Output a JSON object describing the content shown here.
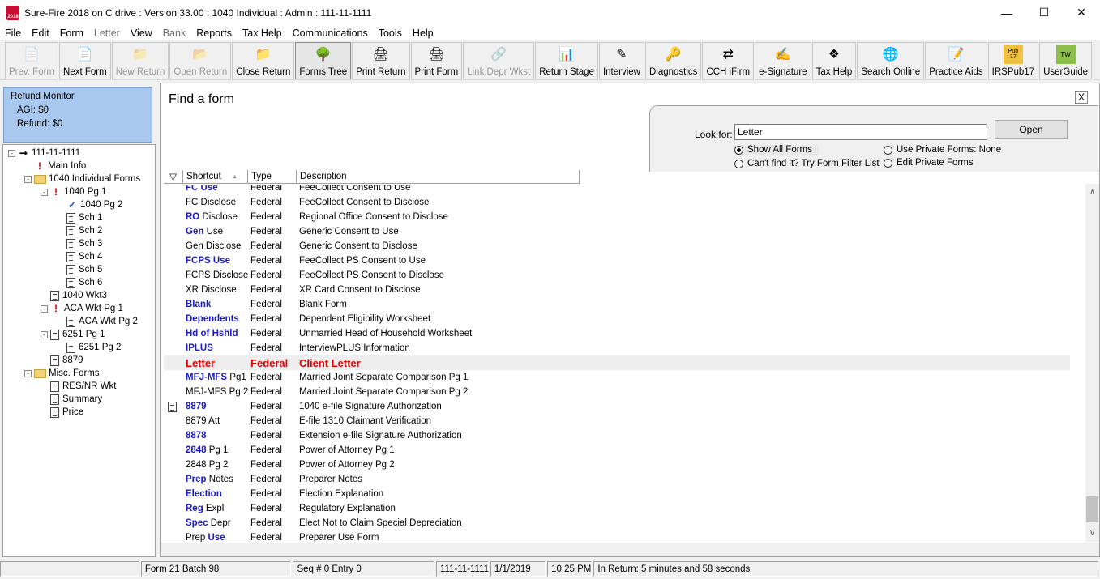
{
  "window": {
    "title": "Sure-Fire 2018 on C drive : Version  33.00 : 1040 Individual : Admin : 111-11-1111",
    "app_icon_text": "2018"
  },
  "menu": [
    "File",
    "Edit",
    "Form",
    "Letter",
    "View",
    "Bank",
    "Reports",
    "Tax Help",
    "Communications",
    "Tools",
    "Help"
  ],
  "menu_disabled": [
    "Letter",
    "Bank"
  ],
  "toolbar": [
    {
      "label": "Prev. Form",
      "icon": "prev-form-icon",
      "disabled": true
    },
    {
      "label": "Next Form",
      "icon": "next-form-icon",
      "disabled": false
    },
    {
      "label": "New Return",
      "icon": "new-return-icon",
      "disabled": true
    },
    {
      "label": "Open Return",
      "icon": "open-return-icon",
      "disabled": true
    },
    {
      "label": "Close Return",
      "icon": "close-return-icon",
      "disabled": false
    },
    {
      "label": "Forms Tree",
      "icon": "forms-tree-icon",
      "disabled": false,
      "active": true
    },
    {
      "label": "Print Return",
      "icon": "printer-icon",
      "disabled": false
    },
    {
      "label": "Print Form",
      "icon": "print-form-icon",
      "disabled": false
    },
    {
      "label": "Link Depr Wkst",
      "icon": "link-icon",
      "disabled": true
    },
    {
      "label": "Return Stage",
      "icon": "return-stage-icon",
      "disabled": false
    },
    {
      "label": "Interview",
      "icon": "interview-icon",
      "disabled": false
    },
    {
      "label": "Diagnostics",
      "icon": "key-icon",
      "disabled": false
    },
    {
      "label": "CCH iFirm",
      "icon": "sync-icon",
      "disabled": false
    },
    {
      "label": "e-Signature",
      "icon": "signature-icon",
      "disabled": false
    },
    {
      "label": "Tax Help",
      "icon": "help-icon",
      "disabled": false
    },
    {
      "label": "Search Online",
      "icon": "globe-icon",
      "disabled": false
    },
    {
      "label": "Practice Aids",
      "icon": "practice-aids-icon",
      "disabled": false
    },
    {
      "label": "IRSPub17",
      "icon": "book-icon",
      "disabled": false
    },
    {
      "label": "UserGuide",
      "icon": "guide-icon",
      "disabled": false
    }
  ],
  "toolbar_icon_text": {
    "pub": "Pub\n17",
    "tw": "TW"
  },
  "refund_monitor": {
    "title": "Refund Monitor",
    "agi": "AGI:  $0",
    "refund": "Refund:  $0"
  },
  "tree": [
    {
      "label": "111-11-1111",
      "kind": "arrow",
      "level": 0,
      "exp": "-"
    },
    {
      "label": "Main Info",
      "kind": "warn",
      "level": 1
    },
    {
      "label": "1040 Individual Forms",
      "kind": "folder",
      "level": 1,
      "exp": "-"
    },
    {
      "label": "1040 Pg 1",
      "kind": "warn",
      "level": 2,
      "exp": "-"
    },
    {
      "label": "1040 Pg 2",
      "kind": "check",
      "level": 3
    },
    {
      "label": "Sch 1",
      "kind": "doc",
      "level": 3
    },
    {
      "label": "Sch 2",
      "kind": "doc",
      "level": 3
    },
    {
      "label": "Sch 3",
      "kind": "doc",
      "level": 3
    },
    {
      "label": "Sch 4",
      "kind": "doc",
      "level": 3
    },
    {
      "label": "Sch 5",
      "kind": "doc",
      "level": 3
    },
    {
      "label": "Sch 6",
      "kind": "doc",
      "level": 3
    },
    {
      "label": "1040 Wkt3",
      "kind": "doc",
      "level": 2
    },
    {
      "label": "ACA Wkt Pg 1",
      "kind": "warn",
      "level": 2,
      "exp": "-"
    },
    {
      "label": "ACA Wkt Pg 2",
      "kind": "doc",
      "level": 3
    },
    {
      "label": "6251 Pg 1",
      "kind": "doc",
      "level": 2,
      "exp": "-"
    },
    {
      "label": "6251 Pg 2",
      "kind": "doc",
      "level": 3
    },
    {
      "label": "8879",
      "kind": "doc",
      "level": 2
    },
    {
      "label": "Misc. Forms",
      "kind": "folder",
      "level": 1,
      "exp": "-"
    },
    {
      "label": "RES/NR Wkt",
      "kind": "doc",
      "level": 2
    },
    {
      "label": "Summary",
      "kind": "doc",
      "level": 2
    },
    {
      "label": "Price",
      "kind": "doc",
      "level": 2
    }
  ],
  "find": {
    "title": "Find a form",
    "close": "X",
    "look_for_label": "Look for:",
    "look_for_value": "Letter",
    "open_label": "Open",
    "radio_show_all": "Show All Forms",
    "radio_cant_find": "Can't find it? Try Form Filter List",
    "radio_private": "Use Private Forms: None",
    "radio_edit_private": "Edit Private Forms"
  },
  "columns": {
    "filter": "▽",
    "shortcut": "Shortcut",
    "sort": "▲",
    "type": "Type",
    "description": "Description"
  },
  "rows": [
    {
      "b": "FC Use",
      "r": "",
      "type": "Federal",
      "desc": "FeeCollect Consent to Use",
      "partial": true
    },
    {
      "b": "",
      "r": "FC Disclose",
      "type": "Federal",
      "desc": "FeeCollect Consent to Disclose"
    },
    {
      "b": "RO",
      "r": " Disclose",
      "type": "Federal",
      "desc": "Regional Office Consent to Disclose"
    },
    {
      "b": "Gen",
      "r": " Use",
      "type": "Federal",
      "desc": "Generic Consent to Use"
    },
    {
      "b": "",
      "r": "Gen Disclose",
      "type": "Federal",
      "desc": "Generic Consent to Disclose"
    },
    {
      "b": "FCPS Use",
      "r": "",
      "type": "Federal",
      "desc": "FeeCollect PS Consent to Use"
    },
    {
      "b": "",
      "r": "FCPS Disclose",
      "type": "Federal",
      "desc": "FeeCollect PS Consent to Disclose"
    },
    {
      "b": "",
      "r": "XR Disclose",
      "type": "Federal",
      "desc": "XR Card Consent to Disclose"
    },
    {
      "b": "Blank",
      "r": "",
      "type": "Federal",
      "desc": "Blank Form"
    },
    {
      "b": "Dependents",
      "r": "",
      "type": "Federal",
      "desc": "Dependent Eligibility Worksheet"
    },
    {
      "b": "Hd of Hshld",
      "r": "",
      "type": "Federal",
      "desc": "Unmarried Head of Household Worksheet"
    },
    {
      "b": "IPLUS",
      "r": "",
      "type": "Federal",
      "desc": "InterviewPLUS Information"
    },
    {
      "b": "Letter",
      "r": "",
      "type": "Federal",
      "desc": "Client Letter",
      "selected": true
    },
    {
      "b": "MFJ-MFS",
      "r": " Pg1",
      "type": "Federal",
      "desc": "Married Joint Separate Comparison Pg 1"
    },
    {
      "b": "",
      "r": "MFJ-MFS Pg 2",
      "type": "Federal",
      "desc": "Married Joint Separate Comparison Pg 2"
    },
    {
      "b": "8879",
      "r": "",
      "type": "Federal",
      "desc": "1040 e-file Signature Authorization",
      "icon": true
    },
    {
      "b": "",
      "r": "8879 Att",
      "type": "Federal",
      "desc": "E-file 1310 Claimant Verification"
    },
    {
      "b": "8878",
      "r": "",
      "type": "Federal",
      "desc": "Extension e-file Signature Authorization"
    },
    {
      "b": "2848",
      "r": " Pg 1",
      "type": "Federal",
      "desc": "Power of Attorney Pg 1"
    },
    {
      "b": "",
      "r": "2848 Pg 2",
      "type": "Federal",
      "desc": "Power of Attorney Pg 2"
    },
    {
      "b": "Prep",
      "r": " Notes",
      "type": "Federal",
      "desc": "Preparer Notes"
    },
    {
      "b": "Election",
      "r": "",
      "type": "Federal",
      "desc": "Election Explanation"
    },
    {
      "b": "Reg",
      "r": " Expl",
      "type": "Federal",
      "desc": "Regulatory Explanation"
    },
    {
      "b": "Spec",
      "r": " Depr",
      "type": "Federal",
      "desc": "Elect Not to Claim Special Depreciation"
    },
    {
      "b": "",
      "r": "Prep ",
      "b2": "Use",
      "type": "Federal",
      "desc": "Preparer Use Form"
    }
  ],
  "status": [
    "",
    "Form 21 Batch 98",
    "Seq # 0 Entry 0",
    "111-11-1111",
    "1/1/2019",
    "10:25 PM",
    "In Return: 5 minutes and 58 seconds"
  ]
}
